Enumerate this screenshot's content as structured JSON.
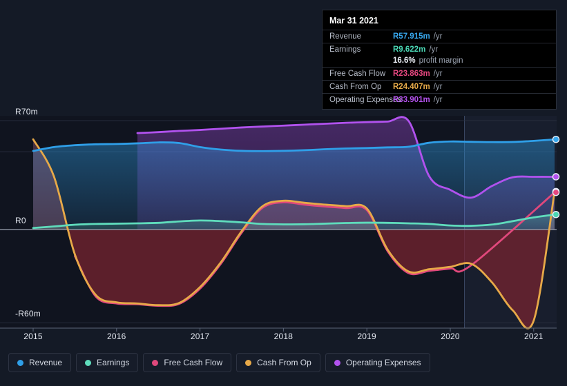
{
  "theme": {
    "background": "#141a26",
    "plot_background": "#10141f",
    "highlight_band": "#1b2233",
    "grid": "#2b3140",
    "zero_line": "#9aa2b0",
    "axis_text": "#e6eaf2"
  },
  "tooltip": {
    "date": "Mar 31 2021",
    "rows": [
      {
        "name": "Revenue",
        "value": "R57.915m",
        "unit": "/yr",
        "color": "#38a8ee"
      },
      {
        "name": "Earnings",
        "value": "R9.622m",
        "unit": "/yr",
        "color": "#4ad6b4"
      },
      {
        "name": "",
        "value": "16.6%",
        "unit": "profit margin",
        "color": "#e9edf4",
        "sub": true
      },
      {
        "name": "Free Cash Flow",
        "value": "R23.863m",
        "unit": "/yr",
        "color": "#e6477f"
      },
      {
        "name": "Cash From Op",
        "value": "R24.407m",
        "unit": "/yr",
        "color": "#e8ab49"
      },
      {
        "name": "Operating Expenses",
        "value": "R33.901m",
        "unit": "/yr",
        "color": "#b452ee"
      }
    ]
  },
  "legend": {
    "items": [
      {
        "label": "Revenue",
        "color": "#2f9fe8"
      },
      {
        "label": "Earnings",
        "color": "#5fdcbc"
      },
      {
        "label": "Free Cash Flow",
        "color": "#e0487c"
      },
      {
        "label": "Cash From Op",
        "color": "#e7a948"
      },
      {
        "label": "Operating Expenses",
        "color": "#b152ee"
      }
    ]
  },
  "chart_data": {
    "type": "area",
    "title": "",
    "xlabel": "",
    "ylabel": "",
    "grid": true,
    "legend_position": "bottom",
    "currency": "R",
    "unit": "m",
    "ylim": [
      -70,
      78
    ],
    "yticks": [
      70,
      0,
      -60
    ],
    "ytick_labels": [
      "R70m",
      "R0",
      "-R60m"
    ],
    "gridlines": [
      70,
      50,
      0,
      -60
    ],
    "x": [
      2015.0,
      2015.25,
      2015.5,
      2015.75,
      2016.0,
      2016.25,
      2016.5,
      2016.75,
      2017.0,
      2017.25,
      2017.5,
      2017.75,
      2018.0,
      2018.25,
      2018.5,
      2018.75,
      2019.0,
      2019.25,
      2019.5,
      2019.75,
      2020.0,
      2020.25,
      2020.5,
      2020.75,
      2021.0,
      2021.25
    ],
    "xticks": [
      2015,
      2016,
      2017,
      2018,
      2019,
      2020,
      2021
    ],
    "xtick_labels": [
      "2015",
      "2016",
      "2017",
      "2018",
      "2019",
      "2020",
      "2021"
    ],
    "highlight_from": 2020.17,
    "highlight_to": 2021.25,
    "series": [
      {
        "name": "Revenue",
        "color": "#2f9fe8",
        "values": [
          50.5,
          53.0,
          54.2,
          54.8,
          55.0,
          55.4,
          56.0,
          55.6,
          53.0,
          51.4,
          50.6,
          50.4,
          50.6,
          51.0,
          51.6,
          52.1,
          52.4,
          52.8,
          53.2,
          55.8,
          56.6,
          56.4,
          56.2,
          56.3,
          57.0,
          57.915
        ]
      },
      {
        "name": "Earnings",
        "color": "#5fdcbc",
        "values": [
          1.0,
          2.0,
          3.1,
          3.6,
          3.8,
          4.0,
          4.3,
          5.2,
          5.8,
          5.4,
          4.6,
          3.6,
          3.3,
          3.4,
          3.8,
          4.2,
          4.4,
          4.3,
          4.0,
          3.6,
          2.6,
          2.4,
          3.2,
          5.4,
          7.8,
          9.622
        ]
      },
      {
        "name": "Free Cash Flow",
        "color": "#e0487c",
        "values": [
          null,
          null,
          -17.0,
          -43.0,
          -47.5,
          -48.0,
          -49.0,
          -47.8,
          -38.0,
          -22.0,
          -2.0,
          14.0,
          17.5,
          16.0,
          14.8,
          13.8,
          12.5,
          -14.0,
          -28.0,
          -26.5,
          -25.0,
          -23.0,
          null,
          null,
          null,
          23.863
        ]
      },
      {
        "name": "Cash From Op",
        "color": "#e7a948",
        "values": [
          58.0,
          34.0,
          -16.0,
          -42.0,
          -46.8,
          -47.5,
          -48.6,
          -47.2,
          -37.0,
          -21.0,
          -1.0,
          15.0,
          18.5,
          17.2,
          16.0,
          15.0,
          13.5,
          -13.0,
          -27.0,
          -25.5,
          -24.0,
          -22.0,
          -34.0,
          -52.0,
          -58.5,
          24.407
        ]
      },
      {
        "name": "Operating Expenses",
        "color": "#b152ee",
        "values": [
          null,
          null,
          null,
          null,
          null,
          62.0,
          62.6,
          63.4,
          64.0,
          64.8,
          65.6,
          66.2,
          66.8,
          67.4,
          68.0,
          68.6,
          69.0,
          69.4,
          69.8,
          34.0,
          25.5,
          20.5,
          28.0,
          33.6,
          33.9,
          33.901
        ]
      }
    ],
    "endpoints": [
      {
        "name": "Revenue",
        "value": 57.915,
        "color": "#38a8ee"
      },
      {
        "name": "Operating Expenses",
        "value": 33.901,
        "color": "#b452ee"
      },
      {
        "name": "Cash From Op",
        "value": 24.407,
        "color": "#e8ab49"
      },
      {
        "name": "Free Cash Flow",
        "value": 23.863,
        "color": "#e6477f"
      },
      {
        "name": "Earnings",
        "value": 9.622,
        "color": "#4ad6b4"
      }
    ]
  }
}
